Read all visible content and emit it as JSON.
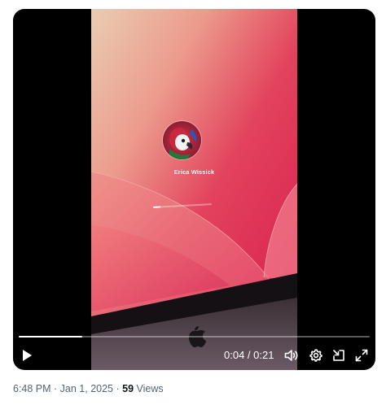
{
  "video": {
    "login_name": "Erica Wissick",
    "login_progress": 0.12,
    "playback_progress": 0.18,
    "current_time": "0:04",
    "separator": " / ",
    "duration": "0:21"
  },
  "icons": {
    "play": "play-icon",
    "volume": "volume-icon",
    "settings": "gear-icon",
    "pip": "picture-in-picture-icon",
    "fullscreen": "fullscreen-icon",
    "avatar": "parrot-avatar",
    "logo": "apple-logo-icon"
  },
  "meta": {
    "time": "6:48 PM",
    "dot1": " · ",
    "date": "Jan 1, 2025",
    "dot2": " · ",
    "views_count": "59",
    "views_label": " Views"
  },
  "colors": {
    "player_bg": "#000000",
    "meta_text": "#536471",
    "meta_strong": "#0f1419"
  }
}
